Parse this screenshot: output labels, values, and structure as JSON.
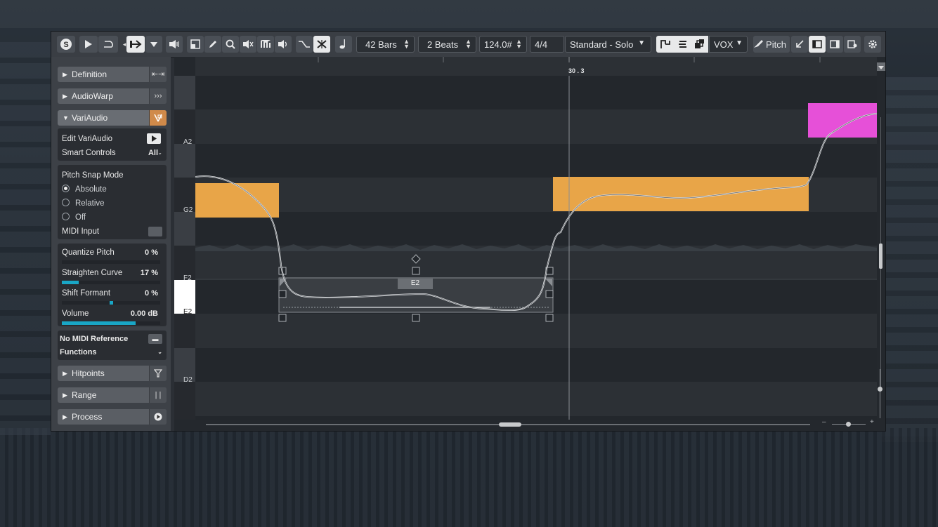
{
  "toolbar": {
    "bars": "42 Bars",
    "beats": "2 Beats",
    "tempo": "124.0#",
    "signature": "4/4",
    "mode": "Standard - Solo",
    "track": "VOX",
    "pitch": "Pitch"
  },
  "inspector": {
    "sections": {
      "definition": "Definition",
      "audiowarp": "AudioWarp",
      "variaudio": "VariAudio",
      "hitpoints": "Hitpoints",
      "range": "Range",
      "process": "Process"
    },
    "edit_variaudio": "Edit VariAudio",
    "smart_controls": "Smart Controls",
    "smart_controls_value": "All",
    "pitch_snap_mode": "Pitch Snap Mode",
    "snap_options": [
      "Absolute",
      "Relative",
      "Off"
    ],
    "snap_selected": "Absolute",
    "midi_input": "MIDI Input",
    "quantize_pitch": {
      "label": "Quantize Pitch",
      "value": "0 %"
    },
    "straighten_curve": {
      "label": "Straighten Curve",
      "value": "17 %",
      "level": 0.17
    },
    "shift_formant": {
      "label": "Shift Formant",
      "value": "0 %",
      "level": 0.5
    },
    "volume": {
      "label": "Volume",
      "value": "0.00 dB",
      "level": 0.75
    },
    "no_midi_reference": "No MIDI Reference",
    "functions": "Functions"
  },
  "editor": {
    "cursor_label": "30 . 3",
    "keys": [
      "A2",
      "G2",
      "F2",
      "E2",
      "D2"
    ],
    "selected_note_label": "E2",
    "colors": {
      "note": "#e8a548",
      "note_pink": "#e650d8",
      "accent": "#19a6c6"
    }
  }
}
